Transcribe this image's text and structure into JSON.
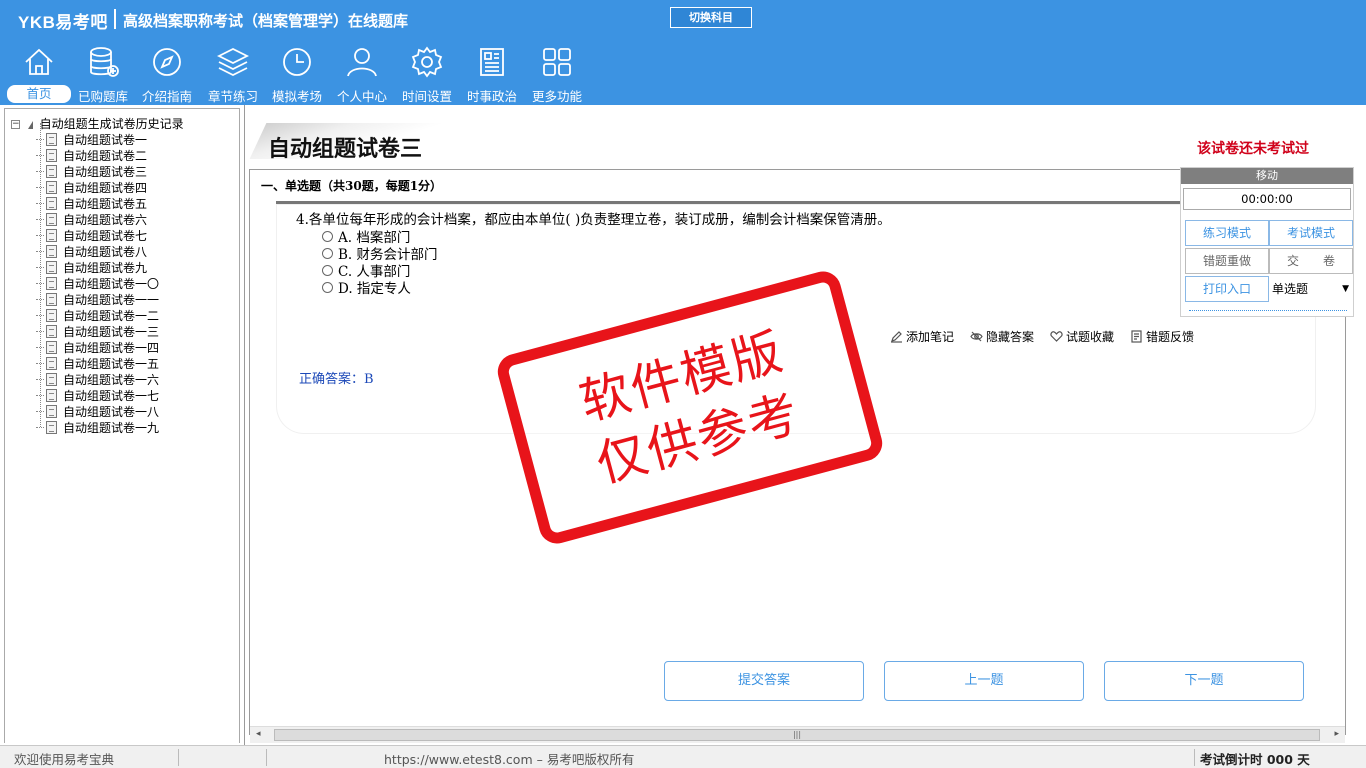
{
  "header": {
    "brand": "YKB易考吧",
    "title": "高级档案职称考试（档案管理学）在线题库",
    "switch_button": "切换科目"
  },
  "nav": [
    {
      "label": "首页",
      "icon": "home-icon",
      "active": true
    },
    {
      "label": "已购题库",
      "icon": "database-icon"
    },
    {
      "label": "介绍指南",
      "icon": "compass-icon"
    },
    {
      "label": "章节练习",
      "icon": "layers-icon"
    },
    {
      "label": "模拟考场",
      "icon": "clock-icon"
    },
    {
      "label": "个人中心",
      "icon": "user-icon"
    },
    {
      "label": "时间设置",
      "icon": "gear-icon"
    },
    {
      "label": "时事政治",
      "icon": "newspaper-icon"
    },
    {
      "label": "更多功能",
      "icon": "grid-icon"
    }
  ],
  "tree": {
    "root": "自动组题生成试卷历史记录",
    "items": [
      "自动组题试卷一",
      "自动组题试卷二",
      "自动组题试卷三",
      "自动组题试卷四",
      "自动组题试卷五",
      "自动组题试卷六",
      "自动组题试卷七",
      "自动组题试卷八",
      "自动组题试卷九",
      "自动组题试卷一〇",
      "自动组题试卷一一",
      "自动组题试卷一二",
      "自动组题试卷一三",
      "自动组题试卷一四",
      "自动组题试卷一五",
      "自动组题试卷一六",
      "自动组题试卷一七",
      "自动组题试卷一八",
      "自动组题试卷一九"
    ]
  },
  "paper": {
    "title": "自动组题试卷三",
    "status": "该试卷还未考试过",
    "section": "一、单选题（共30题，每题1分）"
  },
  "question": {
    "text": "4.各单位每年形成的会计档案，都应由本单位( )负责整理立卷，装订成册，编制会计档案保管清册。",
    "options": [
      "A. 档案部门",
      "B. 财务会计部门",
      "C. 人事部门",
      "D. 指定专人"
    ],
    "answer": "正确答案：B",
    "actions": {
      "note": "添加笔记",
      "hide": "隐藏答案",
      "favorite": "试题收藏",
      "feedback": "错题反馈"
    }
  },
  "stamp": {
    "line1": "软件模版",
    "line2": "仅供参考"
  },
  "buttons": {
    "submit": "提交答案",
    "prev": "上一题",
    "next": "下一题"
  },
  "right_panel": {
    "move": "移动",
    "timer": "00:00:00",
    "practice": "练习模式",
    "exam": "考试模式",
    "redo": "错题重做",
    "hand_in": "交　　卷",
    "print": "打印入口",
    "type_select": "单选题"
  },
  "footer": {
    "welcome": "欢迎使用易考宝典",
    "url": "https://www.etest8.com – 易考吧版权所有",
    "countdown": "考试倒计时 000 天"
  }
}
